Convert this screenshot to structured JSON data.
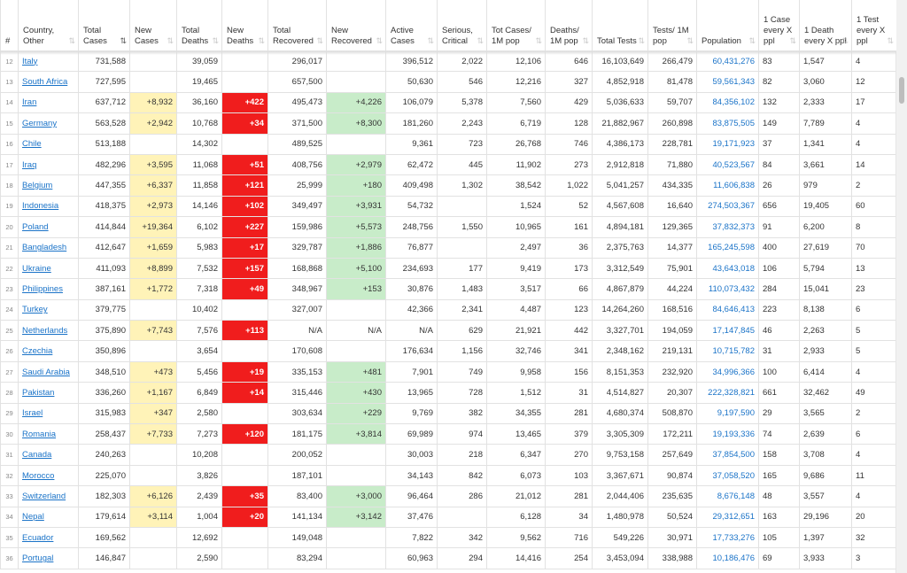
{
  "headers": [
    {
      "label": "#"
    },
    {
      "label": "Country, Other"
    },
    {
      "label": "Total Cases"
    },
    {
      "label": "New Cases"
    },
    {
      "label": "Total Deaths"
    },
    {
      "label": "New Deaths"
    },
    {
      "label": "Total Recovered"
    },
    {
      "label": "New Recovered"
    },
    {
      "label": "Active Cases"
    },
    {
      "label": "Serious, Critical"
    },
    {
      "label": "Tot Cases/ 1M pop"
    },
    {
      "label": "Deaths/ 1M pop"
    },
    {
      "label": "Total Tests"
    },
    {
      "label": "Tests/ 1M pop"
    },
    {
      "label": "Population"
    },
    {
      "label": "1 Case every X ppl"
    },
    {
      "label": "1 Death every X ppl"
    },
    {
      "label": "1 Test every X ppl"
    }
  ],
  "sort_icon": "sort-arrows-icon",
  "colors": {
    "new_cases": "#fff3b8",
    "new_deaths": "#f01d1d",
    "new_recovered": "#c8ecc9",
    "link": "#1a73c8"
  },
  "rows": [
    [
      "12",
      "Italy",
      "731,588",
      "",
      "39,059",
      "",
      "296,017",
      "",
      "396,512",
      "2,022",
      "12,106",
      "646",
      "16,103,649",
      "266,479",
      "60,431,276",
      "83",
      "1,547",
      "4"
    ],
    [
      "13",
      "South Africa",
      "727,595",
      "",
      "19,465",
      "",
      "657,500",
      "",
      "50,630",
      "546",
      "12,216",
      "327",
      "4,852,918",
      "81,478",
      "59,561,343",
      "82",
      "3,060",
      "12"
    ],
    [
      "14",
      "Iran",
      "637,712",
      "+8,932",
      "36,160",
      "+422",
      "495,473",
      "+4,226",
      "106,079",
      "5,378",
      "7,560",
      "429",
      "5,036,633",
      "59,707",
      "84,356,102",
      "132",
      "2,333",
      "17"
    ],
    [
      "15",
      "Germany",
      "563,528",
      "+2,942",
      "10,768",
      "+34",
      "371,500",
      "+8,300",
      "181,260",
      "2,243",
      "6,719",
      "128",
      "21,882,967",
      "260,898",
      "83,875,505",
      "149",
      "7,789",
      "4"
    ],
    [
      "16",
      "Chile",
      "513,188",
      "",
      "14,302",
      "",
      "489,525",
      "",
      "9,361",
      "723",
      "26,768",
      "746",
      "4,386,173",
      "228,781",
      "19,171,923",
      "37",
      "1,341",
      "4"
    ],
    [
      "17",
      "Iraq",
      "482,296",
      "+3,595",
      "11,068",
      "+51",
      "408,756",
      "+2,979",
      "62,472",
      "445",
      "11,902",
      "273",
      "2,912,818",
      "71,880",
      "40,523,567",
      "84",
      "3,661",
      "14"
    ],
    [
      "18",
      "Belgium",
      "447,355",
      "+6,337",
      "11,858",
      "+121",
      "25,999",
      "+180",
      "409,498",
      "1,302",
      "38,542",
      "1,022",
      "5,041,257",
      "434,335",
      "11,606,838",
      "26",
      "979",
      "2"
    ],
    [
      "19",
      "Indonesia",
      "418,375",
      "+2,973",
      "14,146",
      "+102",
      "349,497",
      "+3,931",
      "54,732",
      "",
      "1,524",
      "52",
      "4,567,608",
      "16,640",
      "274,503,367",
      "656",
      "19,405",
      "60"
    ],
    [
      "20",
      "Poland",
      "414,844",
      "+19,364",
      "6,102",
      "+227",
      "159,986",
      "+5,573",
      "248,756",
      "1,550",
      "10,965",
      "161",
      "4,894,181",
      "129,365",
      "37,832,373",
      "91",
      "6,200",
      "8"
    ],
    [
      "21",
      "Bangladesh",
      "412,647",
      "+1,659",
      "5,983",
      "+17",
      "329,787",
      "+1,886",
      "76,877",
      "",
      "2,497",
      "36",
      "2,375,763",
      "14,377",
      "165,245,598",
      "400",
      "27,619",
      "70"
    ],
    [
      "22",
      "Ukraine",
      "411,093",
      "+8,899",
      "7,532",
      "+157",
      "168,868",
      "+5,100",
      "234,693",
      "177",
      "9,419",
      "173",
      "3,312,549",
      "75,901",
      "43,643,018",
      "106",
      "5,794",
      "13"
    ],
    [
      "23",
      "Philippines",
      "387,161",
      "+1,772",
      "7,318",
      "+49",
      "348,967",
      "+153",
      "30,876",
      "1,483",
      "3,517",
      "66",
      "4,867,879",
      "44,224",
      "110,073,432",
      "284",
      "15,041",
      "23"
    ],
    [
      "24",
      "Turkey",
      "379,775",
      "",
      "10,402",
      "",
      "327,007",
      "",
      "42,366",
      "2,341",
      "4,487",
      "123",
      "14,264,260",
      "168,516",
      "84,646,413",
      "223",
      "8,138",
      "6"
    ],
    [
      "25",
      "Netherlands",
      "375,890",
      "+7,743",
      "7,576",
      "+113",
      "N/A",
      "N/A",
      "N/A",
      "629",
      "21,921",
      "442",
      "3,327,701",
      "194,059",
      "17,147,845",
      "46",
      "2,263",
      "5"
    ],
    [
      "26",
      "Czechia",
      "350,896",
      "",
      "3,654",
      "",
      "170,608",
      "",
      "176,634",
      "1,156",
      "32,746",
      "341",
      "2,348,162",
      "219,131",
      "10,715,782",
      "31",
      "2,933",
      "5"
    ],
    [
      "27",
      "Saudi Arabia",
      "348,510",
      "+473",
      "5,456",
      "+19",
      "335,153",
      "+481",
      "7,901",
      "749",
      "9,958",
      "156",
      "8,151,353",
      "232,920",
      "34,996,366",
      "100",
      "6,414",
      "4"
    ],
    [
      "28",
      "Pakistan",
      "336,260",
      "+1,167",
      "6,849",
      "+14",
      "315,446",
      "+430",
      "13,965",
      "728",
      "1,512",
      "31",
      "4,514,827",
      "20,307",
      "222,328,821",
      "661",
      "32,462",
      "49"
    ],
    [
      "29",
      "Israel",
      "315,983",
      "+347",
      "2,580",
      "",
      "303,634",
      "+229",
      "9,769",
      "382",
      "34,355",
      "281",
      "4,680,374",
      "508,870",
      "9,197,590",
      "29",
      "3,565",
      "2"
    ],
    [
      "30",
      "Romania",
      "258,437",
      "+7,733",
      "7,273",
      "+120",
      "181,175",
      "+3,814",
      "69,989",
      "974",
      "13,465",
      "379",
      "3,305,309",
      "172,211",
      "19,193,336",
      "74",
      "2,639",
      "6"
    ],
    [
      "31",
      "Canada",
      "240,263",
      "",
      "10,208",
      "",
      "200,052",
      "",
      "30,003",
      "218",
      "6,347",
      "270",
      "9,753,158",
      "257,649",
      "37,854,500",
      "158",
      "3,708",
      "4"
    ],
    [
      "32",
      "Morocco",
      "225,070",
      "",
      "3,826",
      "",
      "187,101",
      "",
      "34,143",
      "842",
      "6,073",
      "103",
      "3,367,671",
      "90,874",
      "37,058,520",
      "165",
      "9,686",
      "11"
    ],
    [
      "33",
      "Switzerland",
      "182,303",
      "+6,126",
      "2,439",
      "+35",
      "83,400",
      "+3,000",
      "96,464",
      "286",
      "21,012",
      "281",
      "2,044,406",
      "235,635",
      "8,676,148",
      "48",
      "3,557",
      "4"
    ],
    [
      "34",
      "Nepal",
      "179,614",
      "+3,114",
      "1,004",
      "+20",
      "141,134",
      "+3,142",
      "37,476",
      "",
      "6,128",
      "34",
      "1,480,978",
      "50,524",
      "29,312,651",
      "163",
      "29,196",
      "20"
    ],
    [
      "35",
      "Ecuador",
      "169,562",
      "",
      "12,692",
      "",
      "149,048",
      "",
      "7,822",
      "342",
      "9,562",
      "716",
      "549,226",
      "30,971",
      "17,733,276",
      "105",
      "1,397",
      "32"
    ],
    [
      "36",
      "Portugal",
      "146,847",
      "",
      "2,590",
      "",
      "83,294",
      "",
      "60,963",
      "294",
      "14,416",
      "254",
      "3,453,094",
      "338,988",
      "10,186,476",
      "69",
      "3,933",
      "3"
    ]
  ]
}
